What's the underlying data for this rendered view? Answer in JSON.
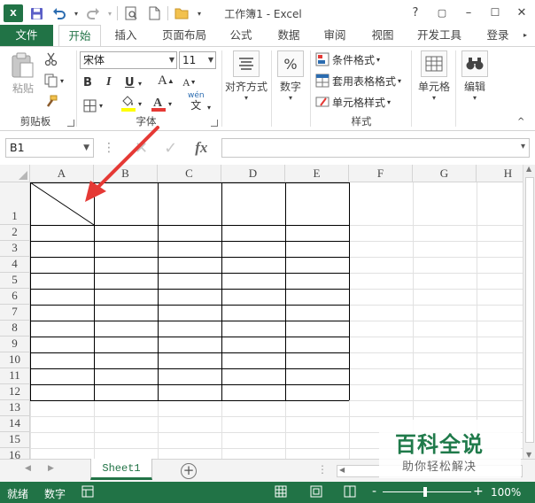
{
  "app": {
    "logo": "X",
    "title": "工作簿1 - Excel",
    "window_controls": [
      "?",
      "▢",
      "–",
      "☐",
      "✕"
    ]
  },
  "qat": {
    "save_icon": "save-icon",
    "undo_icon": "undo-icon",
    "redo_icon": "redo-icon"
  },
  "tabs": {
    "file": "文件",
    "items": [
      "开始",
      "插入",
      "页面布局",
      "公式",
      "数据",
      "审阅",
      "视图",
      "开发工具"
    ],
    "active": "开始",
    "signin": "登录"
  },
  "ribbon": {
    "clipboard": {
      "label": "剪贴板",
      "paste": "粘贴"
    },
    "font": {
      "label": "字体",
      "font_name": "宋体",
      "font_size": "11",
      "bold": "B",
      "italic": "I",
      "underline": "U",
      "grow": "A",
      "shrink": "A",
      "phonetic": "wén",
      "phonetic_sub": "文"
    },
    "alignment": {
      "label": "对齐方式"
    },
    "number": {
      "label": "数字",
      "symbol": "%"
    },
    "styles": {
      "label": "样式",
      "conditional": "条件格式",
      "table": "套用表格格式",
      "cell_styles": "单元格样式"
    },
    "cells": {
      "label": "单元格"
    },
    "editing": {
      "label": "编辑"
    }
  },
  "formula_bar": {
    "name_box": "B1",
    "fx": "fx",
    "content": ""
  },
  "grid": {
    "columns": [
      "A",
      "B",
      "C",
      "D",
      "E",
      "F",
      "G",
      "H"
    ],
    "rows": [
      "1",
      "2",
      "3",
      "4",
      "5",
      "6",
      "7",
      "8",
      "9",
      "10",
      "11",
      "12",
      "13",
      "14",
      "15",
      "16"
    ],
    "table_cols": 5,
    "table_rows": 12
  },
  "sheets": {
    "tabs": [
      "Sheet1"
    ],
    "active": "Sheet1",
    "add": "+"
  },
  "status": {
    "mode": "就绪",
    "num": "数字",
    "zoom": "100%",
    "minus": "-",
    "plus": "+"
  },
  "watermark": {
    "title": "百科全说",
    "subtitle": "助你轻松解决"
  },
  "colors": {
    "accent": "#217346",
    "arrow": "#e53935"
  }
}
